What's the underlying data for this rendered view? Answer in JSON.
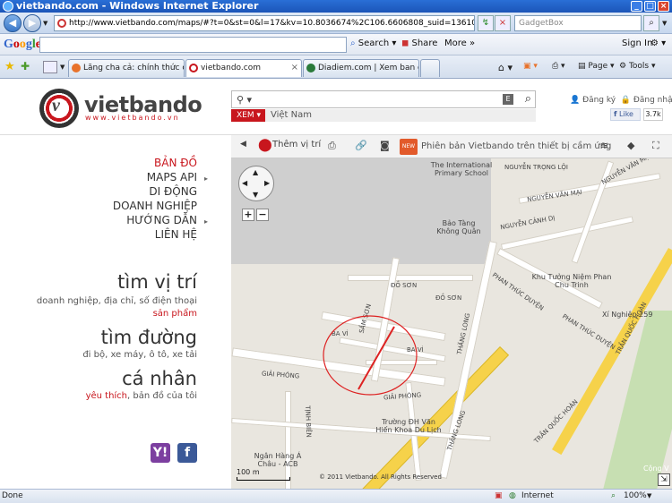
{
  "window": {
    "title": "vietbando.com - Windows Internet Explorer"
  },
  "address_bar": {
    "url": "http://www.vietbando.com/maps/#?t=0&st=0&l=17&kv=10.8036674%2C106.6606808_suid=136109716259309753028..",
    "search_placeholder": "GadgetBox"
  },
  "google_toolbar": {
    "logo": "Google",
    "search_label": "Search",
    "share_label": "Share",
    "more_label": "More",
    "signin_label": "Sign In"
  },
  "tabs": [
    {
      "label": "Lăng cha cả: chính thức cấm ...",
      "active": false
    },
    {
      "label": "vietbando.com",
      "active": true
    },
    {
      "label": "Diadiem.com | Xem ban do T...",
      "active": false
    }
  ],
  "command_bar": {
    "page_label": "Page",
    "tools_label": "Tools"
  },
  "site": {
    "logo_text": "vietbando",
    "logo_url": "www.vietbando.vn",
    "search": {
      "view_button": "XEM",
      "region": "Việt Nam"
    },
    "auth": {
      "register": "Đăng ký",
      "login": "Đăng nhập"
    },
    "facebook": {
      "like": "Like",
      "count": "3.7k"
    }
  },
  "left_menu": [
    {
      "label": "BẢN ĐỒ",
      "active": true,
      "arrow": false
    },
    {
      "label": "MAPS API",
      "active": false,
      "arrow": true
    },
    {
      "label": "DI ĐỘNG",
      "active": false,
      "arrow": false
    },
    {
      "label": "DOANH NGHIỆP",
      "active": false,
      "arrow": false
    },
    {
      "label": "HƯỚNG DẪN",
      "active": false,
      "arrow": true
    },
    {
      "label": "LIÊN HỆ",
      "active": false,
      "arrow": false
    }
  ],
  "features": {
    "find_place": {
      "title": "tìm vị trí",
      "desc": "doanh nghiệp, địa chỉ, số điện thoại",
      "link": "sản phẩm"
    },
    "find_route": {
      "title": "tìm đường",
      "desc": "đi bộ, xe máy, ô tô, xe tải"
    },
    "personal": {
      "title": "cá nhân",
      "link": "yêu thích",
      "desc": ", bản đồ của tôi"
    }
  },
  "map_toolbar": {
    "add_location": "Thêm vị trí",
    "new_badge": "NEW",
    "notice": "Phiên bản Vietbando trên thiết bị cầm ứng"
  },
  "map": {
    "streets": [
      "NGUYỄN TRỌNG LỘI",
      "NGUYỄN VĂN MẠI",
      "NGUYỄN VĂN MẠI",
      "NGUYỄN CẢNH DỊ",
      "ĐỒ SƠN",
      "ĐỒ SƠN",
      "SẦM SƠN",
      "BA VÌ",
      "BA VÌ",
      "THĂNG LONG",
      "PHAN THÚC DUYỆN",
      "PHAN THÚC DUYỆN",
      "GIẢI PHÓNG",
      "GIẢI PHÓNG",
      "TỊNH BIÊN",
      "THĂNG LONG",
      "TRẦN QUỐC HOÀN",
      "TRẦN QUỐC HOÀN"
    ],
    "pois": [
      {
        "name": "The International Primary School"
      },
      {
        "name": "Bảo Tàng Không Quân"
      },
      {
        "name": "Khu Tưởng Niệm Phan Chu Trinh"
      },
      {
        "name": "Xí Nghiệp 259"
      },
      {
        "name": "Trường ĐH Văn Hiến Khoa Du Lịch"
      },
      {
        "name": "Ngân Hàng Á Châu - ACB"
      }
    ],
    "scale": "100 m",
    "copyright": "© 2011 Vietbando. All Rights Reserved",
    "corner_label": "Cộng V"
  },
  "status_bar": {
    "text": "Done",
    "zone": "Internet",
    "zoom": "100%"
  }
}
